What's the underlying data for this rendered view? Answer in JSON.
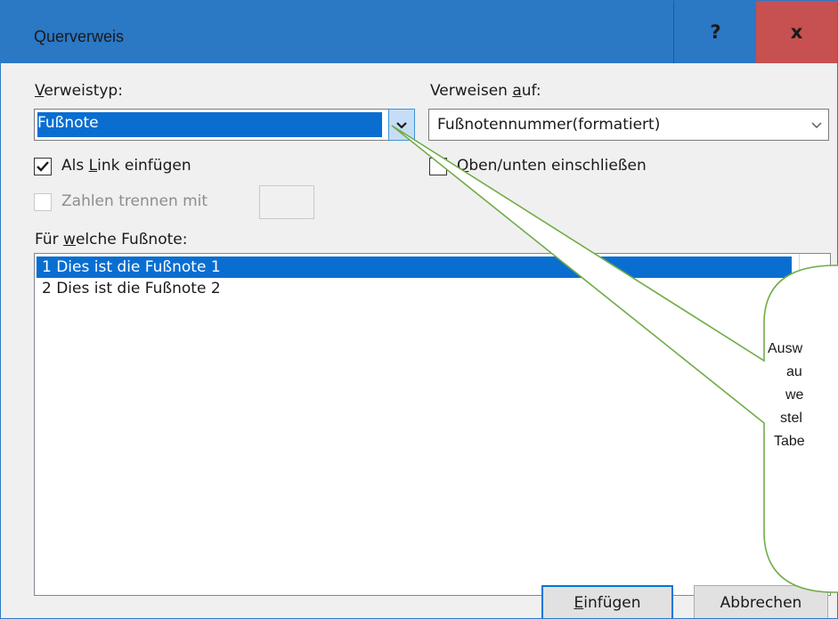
{
  "window": {
    "title": "Querverweis",
    "help_glyph": "?",
    "close_glyph": "x"
  },
  "verweistyp": {
    "label_pre": "",
    "label_u": "V",
    "label_post": "erweistyp:",
    "value": "Fußnote"
  },
  "verweisen_auf": {
    "label_pre": "Verweisen ",
    "label_u": "a",
    "label_post": "uf:",
    "value": "Fußnotennummer(formatiert)"
  },
  "options": {
    "als_link": {
      "pre": "Als ",
      "u": "L",
      "post": "ink einfügen",
      "checked": true
    },
    "oben_unten": {
      "pre": "",
      "u": "O",
      "post": "ben/unten einschließen",
      "checked": false
    },
    "zahlen_trennen": {
      "label": "Zahlen trennen mit",
      "value": "",
      "enabled": false
    }
  },
  "list": {
    "label_pre": "Für ",
    "label_u": "w",
    "label_post": "elche Fußnote:",
    "items": [
      "1  Dies ist die Fußnote 1",
      "2  Dies ist die Fußnote 2"
    ],
    "selected_index": 0
  },
  "buttons": {
    "insert_u": "E",
    "insert_rest": "infügen",
    "cancel": "Abbrechen"
  },
  "callout": {
    "lines": [
      "Ausw",
      "au",
      "we",
      "stel",
      "Tabe"
    ]
  },
  "colors": {
    "titlebar": "#2b78c5",
    "close": "#c75050",
    "selection": "#0a6ed1",
    "callout_border": "#70ad47"
  }
}
